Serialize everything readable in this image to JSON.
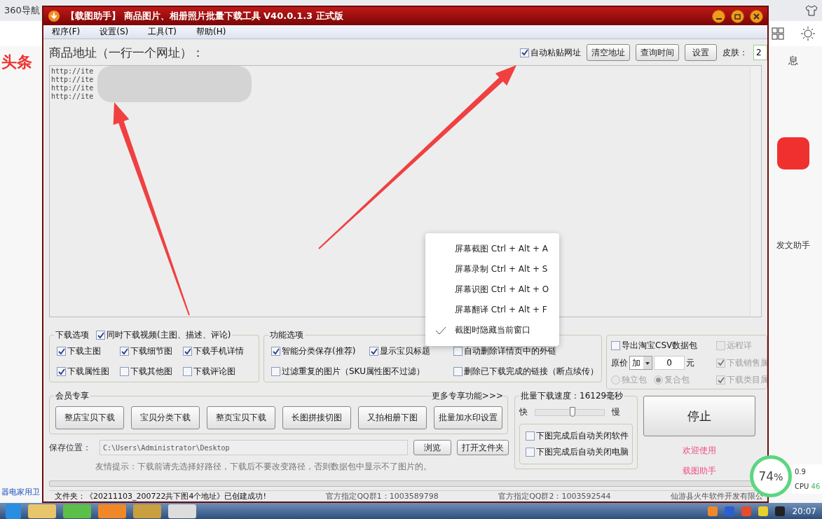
{
  "browser": {
    "tabs": [
      "360导航"
    ],
    "logo": "头条",
    "side_text": "息",
    "side_app": "发文助手",
    "footer_text": "器电家用卫"
  },
  "window": {
    "title": "【载图助手】 商品图片、相册照片批量下载工具 V40.0.1.3 正式版",
    "menu": [
      "程序(F)",
      "设置(S)",
      "工具(T)",
      "帮助(H)"
    ]
  },
  "address": {
    "label": "商品地址（一行一个网址）：",
    "auto_paste": {
      "label": "自动粘贴网址",
      "checked": true
    },
    "buttons": [
      "清空地址",
      "查询时间",
      "设置"
    ],
    "skin_label": "皮肤：",
    "skin_value": "2",
    "lines": [
      "http://ite",
      "http://ite",
      "http://ite",
      "http://ite"
    ]
  },
  "download_options": {
    "title": "下载选项",
    "video": {
      "label": "同时下载视频(主图、描述、评论)",
      "checked": true
    },
    "items": [
      {
        "label": "下载主图",
        "checked": true
      },
      {
        "label": "下载细节图",
        "checked": true
      },
      {
        "label": "下载手机详情",
        "checked": true
      },
      {
        "label": "下载属性图",
        "checked": true
      },
      {
        "label": "下载其他图",
        "checked": false
      },
      {
        "label": "下载评论图",
        "checked": false
      }
    ]
  },
  "function_options": {
    "title": "功能选项",
    "items": [
      {
        "label": "智能分类保存(推荐)",
        "checked": true
      },
      {
        "label": "显示宝贝标题",
        "checked": true
      },
      {
        "label": "自动删除详情页中的外链",
        "checked": false
      },
      {
        "label": "过滤重复的图片（SKU属性图不过滤）",
        "checked": false
      },
      {
        "label": "删除已下载完成的链接（断点续传）",
        "checked": false
      }
    ]
  },
  "export": {
    "items": [
      {
        "kind": "checkbox",
        "label": "导出淘宝CSV数据包",
        "checked": false,
        "disabled": false
      },
      {
        "kind": "checkbox",
        "label": "远程详",
        "checked": false,
        "disabled": true
      },
      {
        "kind": "price",
        "label": "原价",
        "op": "加",
        "value": "0",
        "unit": "元"
      },
      {
        "kind": "checkbox",
        "label": "下载销售属",
        "checked": true,
        "disabled": true
      },
      {
        "kind": "radio",
        "label": "独立包",
        "checked": false,
        "disabled": true
      },
      {
        "kind": "radio",
        "label": "复合包",
        "checked": true,
        "disabled": true
      },
      {
        "kind": "checkbox",
        "label": "下载类目属",
        "checked": true,
        "disabled": true
      }
    ]
  },
  "members": {
    "title": "会员专享",
    "more": "更多专享功能>>>",
    "buttons": [
      "整店宝贝下载",
      "宝贝分类下载",
      "整页宝贝下载",
      "长图拼接切图",
      "又拍相册下图",
      "批量加水印设置"
    ]
  },
  "speed": {
    "title": "批量下载速度：16129毫秒",
    "fast": "快",
    "slow": "慢",
    "level": 0.54,
    "options": [
      {
        "label": "下图完成后自动关闭软件",
        "checked": false
      },
      {
        "label": "下图完成后自动关闭电脑",
        "checked": false
      }
    ]
  },
  "stop": "停止",
  "welcome": [
    "欢迎使用",
    "载图助手"
  ],
  "save": {
    "label": "保存位置：",
    "path": "C:\\Users\\Administrator\\Desktop",
    "buttons": [
      "浏览",
      "打开文件夹"
    ],
    "tip": "友情提示：下载前请先选择好路径，下载后不要改变路径，否则数据包中显示不了图片的。"
  },
  "progress": {
    "level": 0
  },
  "status": [
    "文件夹：《20211103_200722共下图4个地址》已创建成功!",
    "官方指定QQ群1：1003589798",
    "官方指定QQ群2：1003592544",
    "仙游县火牛软件开发有限公"
  ],
  "context_menu": {
    "items": [
      {
        "label": "屏幕截图 Ctrl + Alt + A",
        "checked": false
      },
      {
        "label": "屏幕录制 Ctrl + Alt + S",
        "checked": false
      },
      {
        "label": "屏幕识图 Ctrl + Alt + O",
        "checked": false
      },
      {
        "label": "屏幕翻译 Ctrl + Alt + F",
        "checked": false
      },
      {
        "label": "截图时隐藏当前窗口",
        "checked": true
      }
    ]
  },
  "monitor": {
    "percent": "74",
    "unit": "%",
    "cpu_label": "CPU",
    "cpu_value": "46",
    "net": "0.9"
  },
  "taskbar": {
    "clock": "20:07"
  }
}
